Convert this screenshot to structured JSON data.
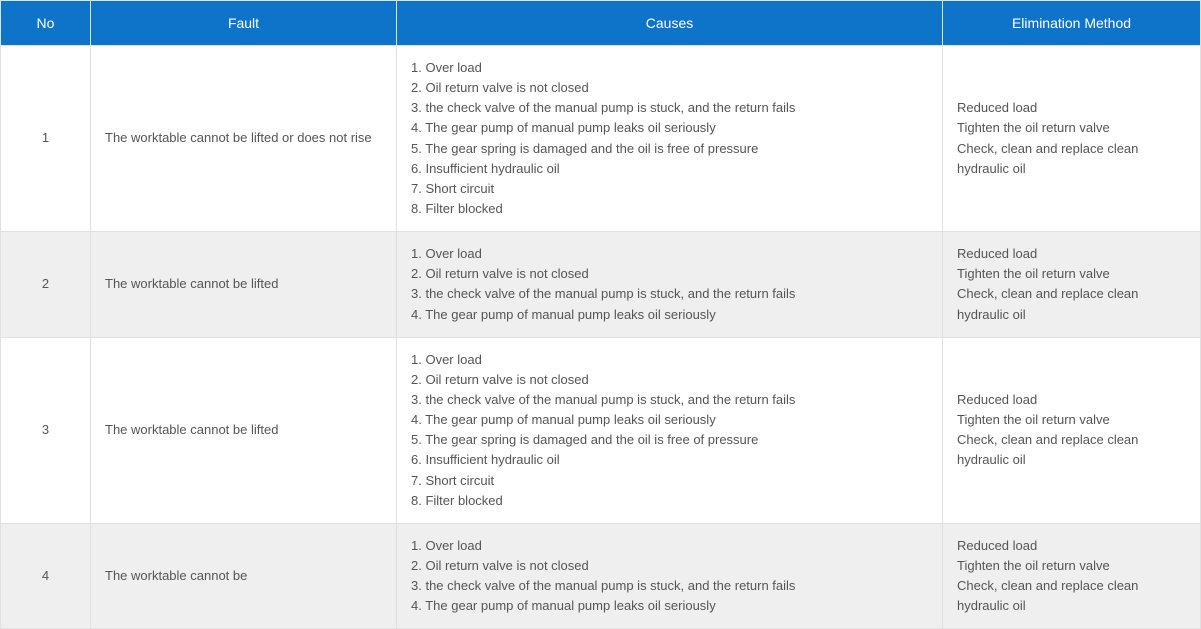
{
  "headers": {
    "no": "No",
    "fault": "Fault",
    "causes": "Causes",
    "elim": "Elimination Method"
  },
  "rows": [
    {
      "no": "1",
      "fault": "The worktable cannot be lifted or does not rise",
      "causes": "1. Over load\n2. Oil return valve is not closed\n3. the check valve of the manual pump is stuck, and the return fails\n4. The gear pump of manual pump leaks oil seriously\n5. The gear spring is damaged and the oil is free of pressure\n6. Insufficient hydraulic oil\n7. Short circuit\n8. Filter blocked",
      "elim": "Reduced load\nTighten the oil return valve\nCheck, clean and replace clean hydraulic oil"
    },
    {
      "no": "2",
      "fault": "The worktable cannot be lifted",
      "causes": "1. Over load\n2. Oil return valve is not closed\n3. the check valve of the manual pump is stuck, and the return fails\n4. The gear pump of manual pump leaks oil seriously",
      "elim": "Reduced load\nTighten the oil return valve\nCheck, clean and replace clean hydraulic oil"
    },
    {
      "no": "3",
      "fault": "The worktable cannot be lifted",
      "causes": "1. Over load\n2. Oil return valve is not closed\n3. the check valve of the manual pump is stuck, and the return fails\n4. The gear pump of manual pump leaks oil seriously\n5. The gear spring is damaged and the oil is free of pressure\n6. Insufficient hydraulic oil\n7. Short circuit\n8. Filter blocked",
      "elim": "Reduced load\nTighten the oil return valve\nCheck, clean and replace clean hydraulic oil"
    },
    {
      "no": "4",
      "fault": "The worktable cannot be",
      "causes": "1. Over load\n2. Oil return valve is not closed\n3. the check valve of the manual pump is stuck, and the return fails\n4. The gear pump of manual pump leaks oil seriously",
      "elim": "Reduced load\nTighten the oil return valve\nCheck, clean and replace clean hydraulic oil"
    }
  ]
}
